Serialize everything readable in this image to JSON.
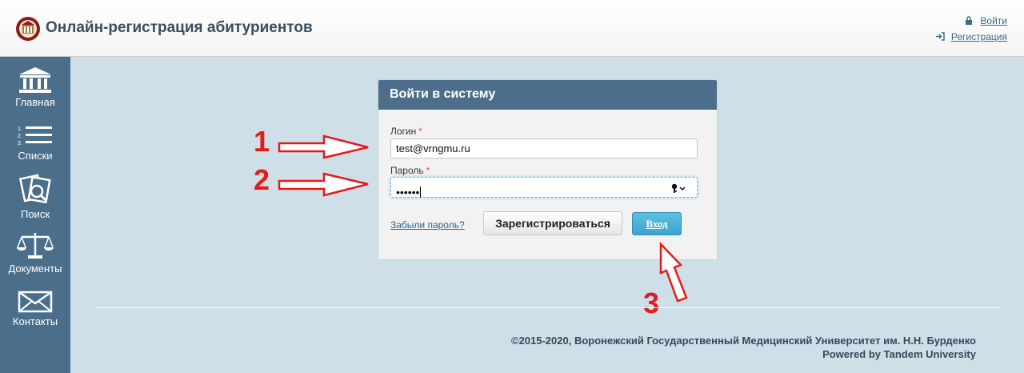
{
  "header": {
    "title": "Онлайн-регистрация абитуриентов",
    "links": [
      {
        "label": "Войти",
        "icon": "lock-icon"
      },
      {
        "label": "Регистрация",
        "icon": "sign-in-icon"
      }
    ]
  },
  "sidebar": {
    "items": [
      {
        "label": "Главная",
        "icon": "building-icon"
      },
      {
        "label": "Списки",
        "icon": "list-icon"
      },
      {
        "label": "Поиск",
        "icon": "search-documents-icon"
      },
      {
        "label": "Документы",
        "icon": "scales-icon"
      },
      {
        "label": "Контакты",
        "icon": "envelope-icon"
      }
    ]
  },
  "login": {
    "title": "Войти в систему",
    "login_label": "Логин",
    "login_value": "test@vrngmu.ru",
    "password_label": "Пароль",
    "password_value": "••••••",
    "required_mark": "*",
    "forgot_link": "Забыли пароль?",
    "register_button": "Зарегистрироваться",
    "login_button": "Вход"
  },
  "annotations": [
    "1",
    "2",
    "3"
  ],
  "footer": {
    "line1": "©2015-2020, Воронежский Государственный Медицинский Университет им. Н.Н. Бурденко",
    "line2": "Powered by Tandem University"
  },
  "colors": {
    "sidebar": "#4b6f8b",
    "panel_header": "#4c6e8b",
    "background": "#cfdfe8",
    "annotation": "#e41b1b",
    "login_button": "#3aa3cf"
  }
}
